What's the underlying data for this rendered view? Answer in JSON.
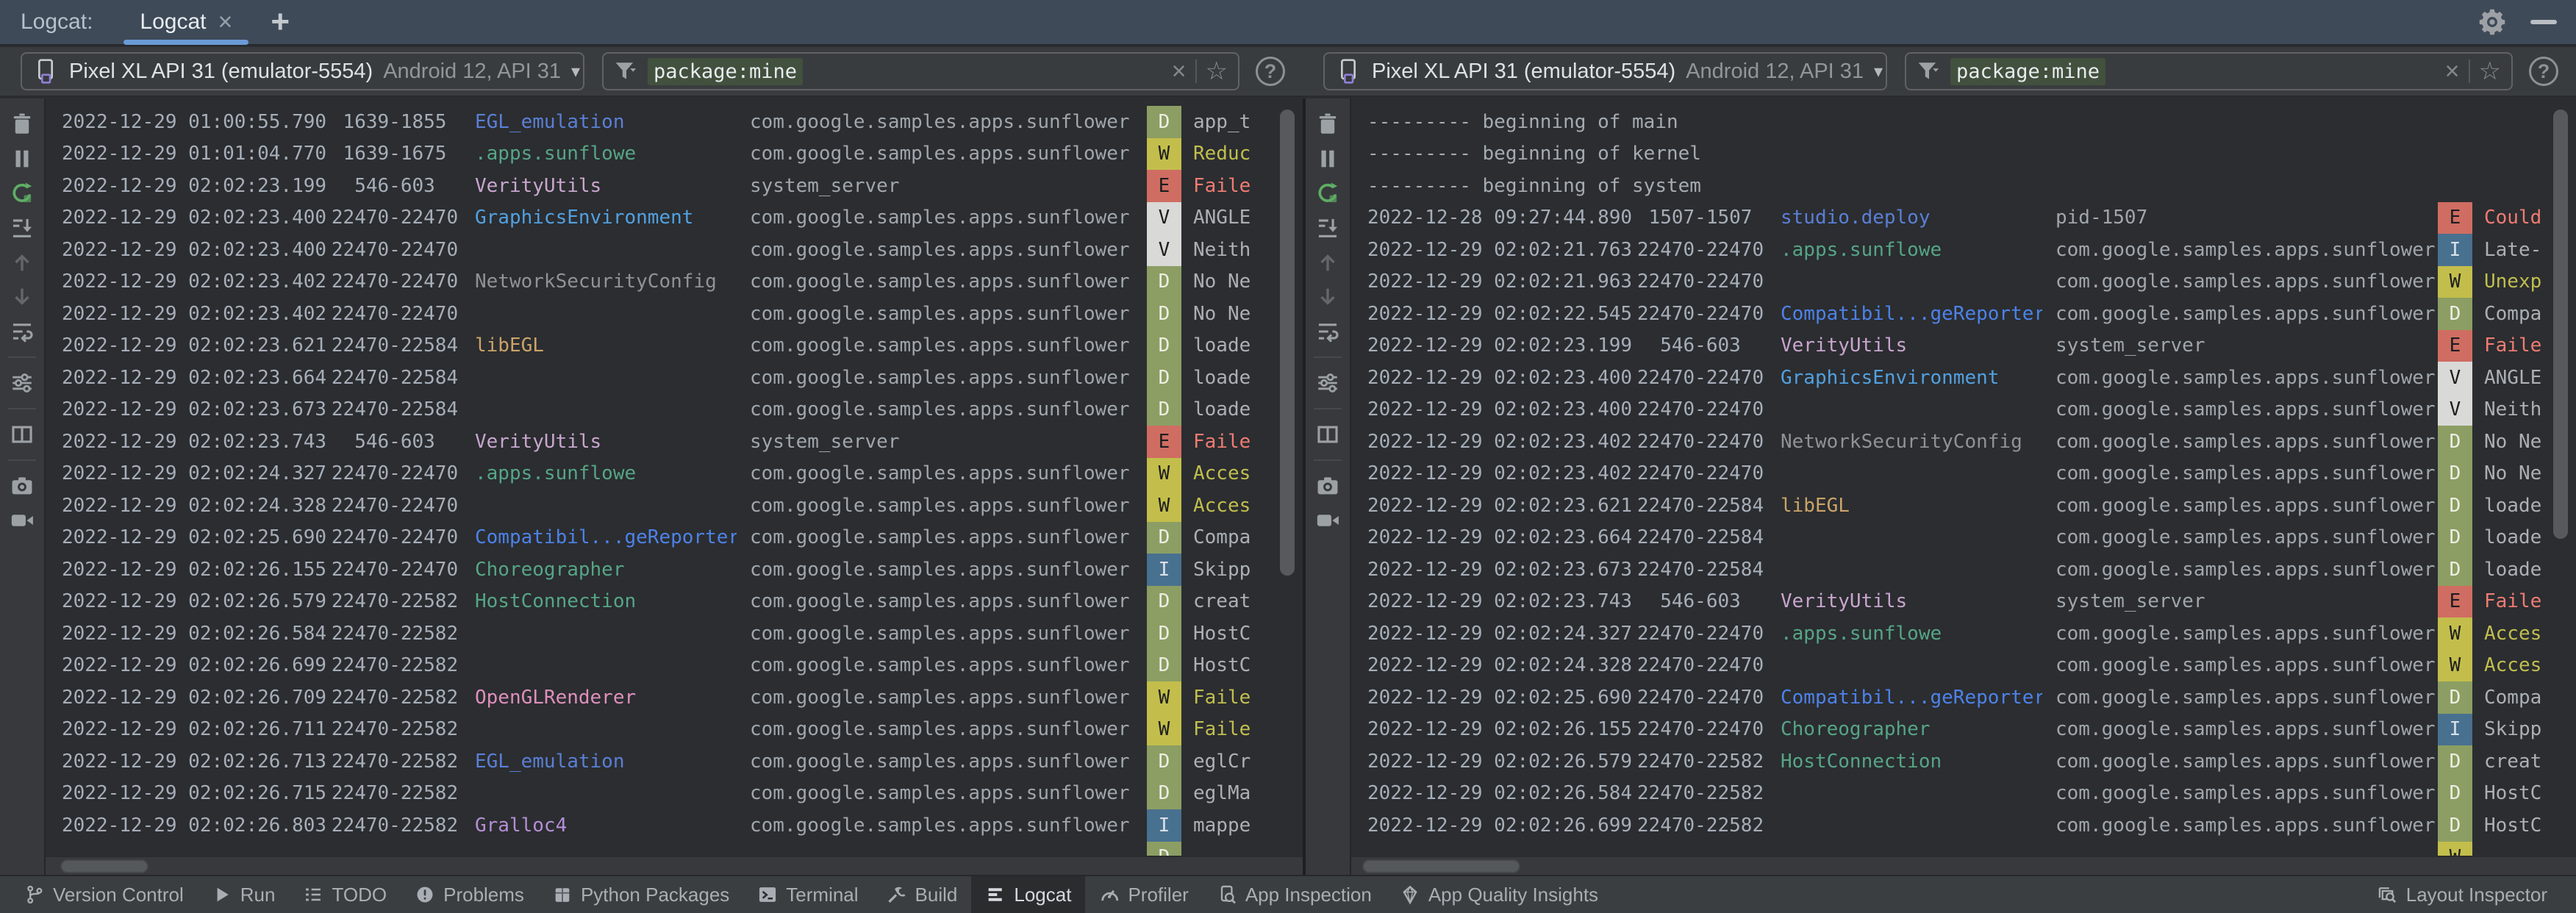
{
  "window": {
    "panel_label": "Logcat:",
    "tab_title": "Logcat",
    "tab_close": "×",
    "new_tab": "+"
  },
  "device_selector": {
    "name": "Pixel XL API 31 (emulator-5554)",
    "details": "Android 12, API 31",
    "caret": "▾"
  },
  "filter": {
    "value": "package:mine",
    "clear": "×",
    "favorite": "☆",
    "help": "?"
  },
  "log_toolbar": [
    {
      "name": "clear-logcat-icon"
    },
    {
      "name": "pause-logcat-icon"
    },
    {
      "name": "restart-logcat-icon",
      "accent": true
    },
    {
      "name": "scroll-to-end-icon"
    },
    {
      "name": "previous-occurrence-icon",
      "disabled": true
    },
    {
      "name": "next-occurrence-icon",
      "disabled": true
    },
    {
      "name": "soft-wrap-icon"
    },
    {
      "name": "separator"
    },
    {
      "name": "logcat-formatting-icon"
    },
    {
      "name": "separator"
    },
    {
      "name": "split-panels-icon"
    },
    {
      "name": "separator"
    },
    {
      "name": "screenshot-icon"
    },
    {
      "name": "screen-record-icon"
    }
  ],
  "panes": {
    "left": {
      "rows": [
        {
          "time": "2022-12-29 01:00:55.790",
          "pid": "1639-1855",
          "tag": "EGL_emulation",
          "tag_color": "blue",
          "package": "com.google.samples.apps.sunflower",
          "level": "D",
          "msg": "app_t"
        },
        {
          "time": "2022-12-29 01:01:04.770",
          "pid": "1639-1675",
          "tag": ".apps.sunflowe",
          "tag_color": "teal",
          "package": "com.google.samples.apps.sunflower",
          "level": "W",
          "msg": "Reduc"
        },
        {
          "time": "2022-12-29 02:02:23.199",
          "pid": "546-603",
          "tag": "VerityUtils",
          "tag_color": "pink",
          "package": "system_server",
          "level": "E",
          "msg": "Faile"
        },
        {
          "time": "2022-12-29 02:02:23.400",
          "pid": "22470-22470",
          "tag": "GraphicsEnvironment",
          "tag_color": "lightblue",
          "package": "com.google.samples.apps.sunflower",
          "level": "V",
          "msg": "ANGLE"
        },
        {
          "time": "2022-12-29 02:02:23.400",
          "pid": "22470-22470",
          "tag": "",
          "tag_color": "gray",
          "package": "com.google.samples.apps.sunflower",
          "level": "V",
          "msg": "Neith"
        },
        {
          "time": "2022-12-29 02:02:23.402",
          "pid": "22470-22470",
          "tag": "NetworkSecurityConfig",
          "tag_color": "gray",
          "package": "com.google.samples.apps.sunflower",
          "level": "D",
          "msg": "No Ne"
        },
        {
          "time": "2022-12-29 02:02:23.402",
          "pid": "22470-22470",
          "tag": "",
          "tag_color": "gray",
          "package": "com.google.samples.apps.sunflower",
          "level": "D",
          "msg": "No Ne"
        },
        {
          "time": "2022-12-29 02:02:23.621",
          "pid": "22470-22584",
          "tag": "libEGL",
          "tag_color": "tan",
          "package": "com.google.samples.apps.sunflower",
          "level": "D",
          "msg": "loade"
        },
        {
          "time": "2022-12-29 02:02:23.664",
          "pid": "22470-22584",
          "tag": "",
          "tag_color": "gray",
          "package": "com.google.samples.apps.sunflower",
          "level": "D",
          "msg": "loade"
        },
        {
          "time": "2022-12-29 02:02:23.673",
          "pid": "22470-22584",
          "tag": "",
          "tag_color": "gray",
          "package": "com.google.samples.apps.sunflower",
          "level": "D",
          "msg": "loade"
        },
        {
          "time": "2022-12-29 02:02:23.743",
          "pid": "546-603",
          "tag": "VerityUtils",
          "tag_color": "pink",
          "package": "system_server",
          "level": "E",
          "msg": "Faile"
        },
        {
          "time": "2022-12-29 02:02:24.327",
          "pid": "22470-22470",
          "tag": ".apps.sunflowe",
          "tag_color": "teal",
          "package": "com.google.samples.apps.sunflower",
          "level": "W",
          "msg": "Acces"
        },
        {
          "time": "2022-12-29 02:02:24.328",
          "pid": "22470-22470",
          "tag": "",
          "tag_color": "gray",
          "package": "com.google.samples.apps.sunflower",
          "level": "W",
          "msg": "Acces"
        },
        {
          "time": "2022-12-29 02:02:25.690",
          "pid": "22470-22470",
          "tag": "Compatibil...geReporter",
          "tag_color": "brightblue",
          "package": "com.google.samples.apps.sunflower",
          "level": "D",
          "msg": "Compa"
        },
        {
          "time": "2022-12-29 02:02:26.155",
          "pid": "22470-22470",
          "tag": "Choreographer",
          "tag_color": "teal",
          "package": "com.google.samples.apps.sunflower",
          "level": "I",
          "msg": "Skipp"
        },
        {
          "time": "2022-12-29 02:02:26.579",
          "pid": "22470-22582",
          "tag": "HostConnection",
          "tag_color": "teal",
          "package": "com.google.samples.apps.sunflower",
          "level": "D",
          "msg": "creat"
        },
        {
          "time": "2022-12-29 02:02:26.584",
          "pid": "22470-22582",
          "tag": "",
          "tag_color": "gray",
          "package": "com.google.samples.apps.sunflower",
          "level": "D",
          "msg": "HostC"
        },
        {
          "time": "2022-12-29 02:02:26.699",
          "pid": "22470-22582",
          "tag": "",
          "tag_color": "gray",
          "package": "com.google.samples.apps.sunflower",
          "level": "D",
          "msg": "HostC"
        },
        {
          "time": "2022-12-29 02:02:26.709",
          "pid": "22470-22582",
          "tag": "OpenGLRenderer",
          "tag_color": "rose",
          "package": "com.google.samples.apps.sunflower",
          "level": "W",
          "msg": "Faile"
        },
        {
          "time": "2022-12-29 02:02:26.711",
          "pid": "22470-22582",
          "tag": "",
          "tag_color": "gray",
          "package": "com.google.samples.apps.sunflower",
          "level": "W",
          "msg": "Faile"
        },
        {
          "time": "2022-12-29 02:02:26.713",
          "pid": "22470-22582",
          "tag": "EGL_emulation",
          "tag_color": "blue",
          "package": "com.google.samples.apps.sunflower",
          "level": "D",
          "msg": "eglCr"
        },
        {
          "time": "2022-12-29 02:02:26.715",
          "pid": "22470-22582",
          "tag": "",
          "tag_color": "gray",
          "package": "com.google.samples.apps.sunflower",
          "level": "D",
          "msg": "eglMa"
        },
        {
          "time": "2022-12-29 02:02:26.803",
          "pid": "22470-22582",
          "tag": "Gralloc4",
          "tag_color": "lavender",
          "package": "com.google.samples.apps.sunflower",
          "level": "I",
          "msg": "mappe"
        },
        {
          "time": "",
          "pid": "",
          "tag": "",
          "tag_color": "gray",
          "package": "",
          "level": "D",
          "msg": "",
          "partial": true
        }
      ]
    },
    "right": {
      "rows": [
        {
          "banner": "--------- beginning of main"
        },
        {
          "banner": "--------- beginning of kernel"
        },
        {
          "banner": "--------- beginning of system"
        },
        {
          "time": "2022-12-28 09:27:44.890",
          "pid": "1507-1507",
          "tag": "studio.deploy",
          "tag_color": "blue",
          "package": "pid-1507",
          "level": "E",
          "msg": "Could"
        },
        {
          "time": "2022-12-29 02:02:21.763",
          "pid": "22470-22470",
          "tag": ".apps.sunflowe",
          "tag_color": "teal",
          "package": "com.google.samples.apps.sunflower",
          "level": "I",
          "msg": "Late-"
        },
        {
          "time": "2022-12-29 02:02:21.963",
          "pid": "22470-22470",
          "tag": "",
          "tag_color": "gray",
          "package": "com.google.samples.apps.sunflower",
          "level": "W",
          "msg": "Unexp"
        },
        {
          "time": "2022-12-29 02:02:22.545",
          "pid": "22470-22470",
          "tag": "Compatibil...geReporter",
          "tag_color": "brightblue",
          "package": "com.google.samples.apps.sunflower",
          "level": "D",
          "msg": "Compa"
        },
        {
          "time": "2022-12-29 02:02:23.199",
          "pid": "546-603",
          "tag": "VerityUtils",
          "tag_color": "pink",
          "package": "system_server",
          "level": "E",
          "msg": "Faile"
        },
        {
          "time": "2022-12-29 02:02:23.400",
          "pid": "22470-22470",
          "tag": "GraphicsEnvironment",
          "tag_color": "lightblue",
          "package": "com.google.samples.apps.sunflower",
          "level": "V",
          "msg": "ANGLE"
        },
        {
          "time": "2022-12-29 02:02:23.400",
          "pid": "22470-22470",
          "tag": "",
          "tag_color": "gray",
          "package": "com.google.samples.apps.sunflower",
          "level": "V",
          "msg": "Neith"
        },
        {
          "time": "2022-12-29 02:02:23.402",
          "pid": "22470-22470",
          "tag": "NetworkSecurityConfig",
          "tag_color": "gray",
          "package": "com.google.samples.apps.sunflower",
          "level": "D",
          "msg": "No Ne"
        },
        {
          "time": "2022-12-29 02:02:23.402",
          "pid": "22470-22470",
          "tag": "",
          "tag_color": "gray",
          "package": "com.google.samples.apps.sunflower",
          "level": "D",
          "msg": "No Ne"
        },
        {
          "time": "2022-12-29 02:02:23.621",
          "pid": "22470-22584",
          "tag": "libEGL",
          "tag_color": "tan",
          "package": "com.google.samples.apps.sunflower",
          "level": "D",
          "msg": "loade"
        },
        {
          "time": "2022-12-29 02:02:23.664",
          "pid": "22470-22584",
          "tag": "",
          "tag_color": "gray",
          "package": "com.google.samples.apps.sunflower",
          "level": "D",
          "msg": "loade"
        },
        {
          "time": "2022-12-29 02:02:23.673",
          "pid": "22470-22584",
          "tag": "",
          "tag_color": "gray",
          "package": "com.google.samples.apps.sunflower",
          "level": "D",
          "msg": "loade"
        },
        {
          "time": "2022-12-29 02:02:23.743",
          "pid": "546-603",
          "tag": "VerityUtils",
          "tag_color": "pink",
          "package": "system_server",
          "level": "E",
          "msg": "Faile"
        },
        {
          "time": "2022-12-29 02:02:24.327",
          "pid": "22470-22470",
          "tag": ".apps.sunflowe",
          "tag_color": "teal",
          "package": "com.google.samples.apps.sunflower",
          "level": "W",
          "msg": "Acces"
        },
        {
          "time": "2022-12-29 02:02:24.328",
          "pid": "22470-22470",
          "tag": "",
          "tag_color": "gray",
          "package": "com.google.samples.apps.sunflower",
          "level": "W",
          "msg": "Acces"
        },
        {
          "time": "2022-12-29 02:02:25.690",
          "pid": "22470-22470",
          "tag": "Compatibil...geReporter",
          "tag_color": "brightblue",
          "package": "com.google.samples.apps.sunflower",
          "level": "D",
          "msg": "Compa"
        },
        {
          "time": "2022-12-29 02:02:26.155",
          "pid": "22470-22470",
          "tag": "Choreographer",
          "tag_color": "teal",
          "package": "com.google.samples.apps.sunflower",
          "level": "I",
          "msg": "Skipp"
        },
        {
          "time": "2022-12-29 02:02:26.579",
          "pid": "22470-22582",
          "tag": "HostConnection",
          "tag_color": "teal",
          "package": "com.google.samples.apps.sunflower",
          "level": "D",
          "msg": "creat"
        },
        {
          "time": "2022-12-29 02:02:26.584",
          "pid": "22470-22582",
          "tag": "",
          "tag_color": "gray",
          "package": "com.google.samples.apps.sunflower",
          "level": "D",
          "msg": "HostC"
        },
        {
          "time": "2022-12-29 02:02:26.699",
          "pid": "22470-22582",
          "tag": "",
          "tag_color": "gray",
          "package": "com.google.samples.apps.sunflower",
          "level": "D",
          "msg": "HostC"
        },
        {
          "time": "",
          "pid": "",
          "tag": "",
          "tag_color": "gray",
          "package": "",
          "level": "W",
          "msg": "",
          "partial": true
        }
      ]
    }
  },
  "statusbar": {
    "left_items": [
      {
        "label": "Version Control",
        "icon": "version-control"
      },
      {
        "label": "Run",
        "icon": "run"
      },
      {
        "label": "TODO",
        "icon": "todo"
      },
      {
        "label": "Problems",
        "icon": "problems"
      },
      {
        "label": "Python Packages",
        "icon": "python-packages"
      },
      {
        "label": "Terminal",
        "icon": "terminal"
      },
      {
        "label": "Build",
        "icon": "build"
      },
      {
        "label": "Logcat",
        "icon": "logcat",
        "active": true
      },
      {
        "label": "Profiler",
        "icon": "profiler"
      },
      {
        "label": "App Inspection",
        "icon": "app-inspection"
      },
      {
        "label": "App Quality Insights",
        "icon": "app-quality-insights"
      }
    ],
    "right_items": [
      {
        "label": "Layout Inspector",
        "icon": "layout-inspector"
      }
    ]
  },
  "colors": {
    "tab_bar_bg": "#3E4A58",
    "tab_underline": "#6B9BD7",
    "toolbar_bg": "#393C3E",
    "log_bg": "#2B2D30",
    "statusbar_bg": "#3B3E40",
    "accent_green": "#5FAD65",
    "device_icon_purple": "#8E80D8",
    "filter_highlight_bg": "#42503E",
    "timestamp": "#A6AEB9",
    "package_text": "#A0A6AD",
    "banner_text": "#A5ABB3",
    "levels": {
      "D": {
        "bg": "#8C9E63",
        "fg": "#ECEEE3"
      },
      "W": {
        "bg": "#C3BE4B",
        "fg": "#1C1E20"
      },
      "E": {
        "bg": "#CF6D62",
        "fg": "#1C1E20"
      },
      "V": {
        "bg": "#D9D9D7",
        "fg": "#1C1E20"
      },
      "I": {
        "bg": "#48708F",
        "fg": "#D9E0E8"
      }
    },
    "messages": {
      "default": "#ABB0B6",
      "W": "#C1BE4F",
      "E": "#F07B73"
    },
    "tags": {
      "blue": "#5A7FD6",
      "brightblue": "#4D82E8",
      "lightblue": "#52A0E0",
      "teal": "#56A586",
      "pink": "#C9A5CE",
      "lavender": "#B48ED6",
      "rose": "#DE8FBB",
      "tan": "#CBA369",
      "gray": "#8E9398"
    }
  }
}
